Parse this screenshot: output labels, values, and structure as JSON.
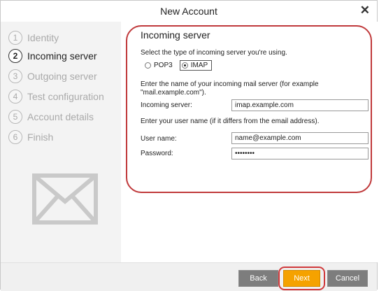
{
  "window": {
    "title": "New Account"
  },
  "steps": [
    {
      "num": "1",
      "label": "Identity"
    },
    {
      "num": "2",
      "label": "Incoming server"
    },
    {
      "num": "3",
      "label": "Outgoing server"
    },
    {
      "num": "4",
      "label": "Test configuration"
    },
    {
      "num": "5",
      "label": "Account details"
    },
    {
      "num": "6",
      "label": "Finish"
    }
  ],
  "panel": {
    "title": "Incoming server",
    "type_prompt": "Select the type of incoming server you're using.",
    "pop3_label": "POP3",
    "imap_label": "IMAP",
    "selected_type": "IMAP",
    "server_prompt_1": "Enter the name of your incoming mail server (for example",
    "server_prompt_2": "\"mail.example.com\").",
    "incoming_server_label": "Incoming server:",
    "incoming_server_value": "imap.example.com",
    "username_prompt": "Enter your user name (if it differs from the email address).",
    "username_label": "User name:",
    "username_value": "name@example.com",
    "password_label": "Password:",
    "password_value": "••••••••"
  },
  "footer": {
    "back_label": "Back",
    "next_label": "Next",
    "cancel_label": "Cancel"
  },
  "colors": {
    "highlight": "#c0393b",
    "next_button": "#f5a200",
    "secondary_button": "#7d7d7d"
  }
}
